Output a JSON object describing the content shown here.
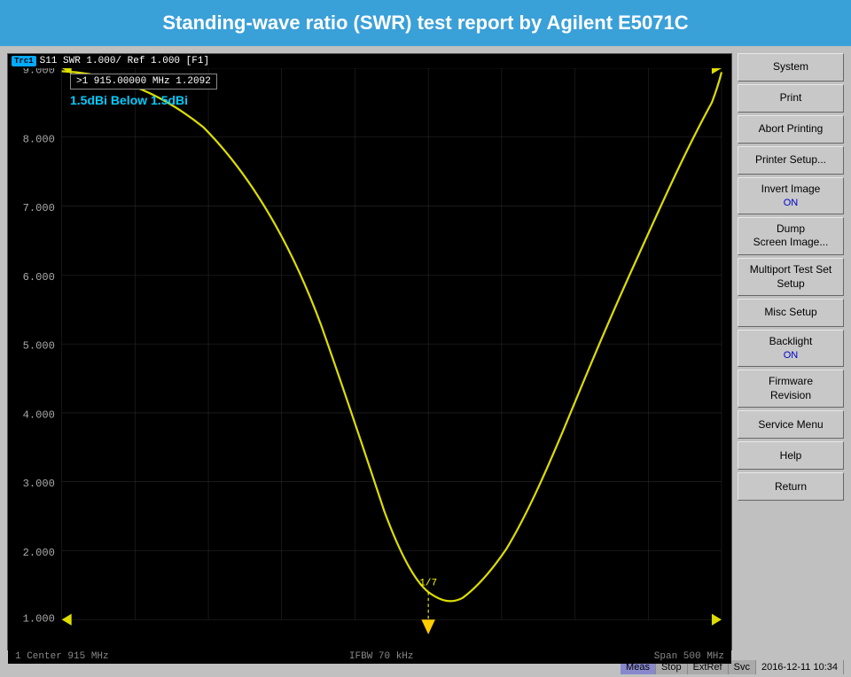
{
  "title": "Standing-wave ratio (SWR) test report by Agilent E5071C",
  "chart": {
    "header": "S11  SWR 1.000/ Ref 1.000  [F1]",
    "trc_label": "Trc1",
    "marker": ">1   915.00000 MHz   1.2092",
    "annotation": "1.5dBi Below 1.5dBi",
    "y_labels": [
      "9.000",
      "8.000",
      "7.000",
      "6.000",
      "5.000",
      "4.000",
      "3.000",
      "2.000",
      "1.000"
    ],
    "footer_left": "1  Center 915 MHz",
    "footer_center": "IFBW 70 kHz",
    "footer_right": "Span 500 MHz"
  },
  "right_panel": {
    "buttons": [
      {
        "label": "System",
        "sub": "",
        "id": "system"
      },
      {
        "label": "Print",
        "sub": "",
        "id": "print"
      },
      {
        "label": "Abort Printing",
        "sub": "",
        "id": "abort-printing"
      },
      {
        "label": "Printer Setup...",
        "sub": "",
        "id": "printer-setup"
      },
      {
        "label": "Invert Image",
        "sub": "ON",
        "id": "invert-image"
      },
      {
        "label": "Dump\nScreen Image...",
        "sub": "",
        "id": "dump-screen"
      },
      {
        "label": "Multiport Test Set\nSetup",
        "sub": "",
        "id": "multiport"
      },
      {
        "label": "Misc Setup",
        "sub": "",
        "id": "misc-setup"
      },
      {
        "label": "Backlight",
        "sub": "ON",
        "id": "backlight"
      },
      {
        "label": "Firmware\nRevision",
        "sub": "",
        "id": "firmware"
      },
      {
        "label": "Service Menu",
        "sub": "",
        "id": "service-menu"
      },
      {
        "label": "Help",
        "sub": "",
        "id": "help"
      },
      {
        "label": "Return",
        "sub": "",
        "id": "return"
      }
    ]
  },
  "status_bar": {
    "meas": "Meas",
    "stop": "Stop",
    "extref": "ExtRef",
    "svc": "Svc",
    "time": "2016-12-11 10:34"
  }
}
